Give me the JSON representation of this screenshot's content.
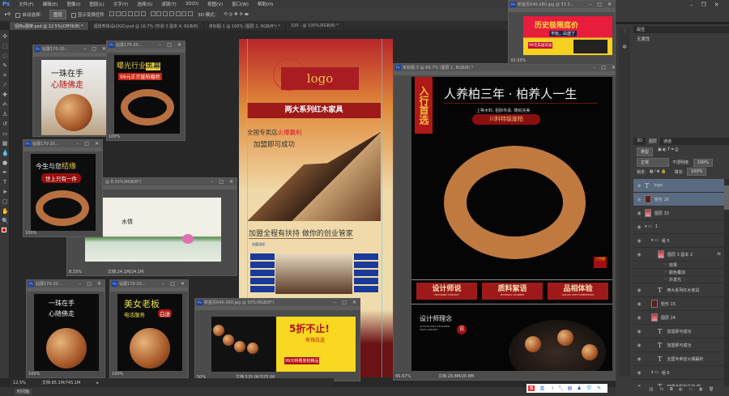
{
  "app": {
    "logo": "Ps",
    "menu": [
      "文件(F)",
      "编辑(E)",
      "图像(I)",
      "图层(L)",
      "文字(Y)",
      "选择(S)",
      "滤镜(T)",
      "3D(D)",
      "视图(V)",
      "窗口(W)",
      "帮助(H)"
    ]
  },
  "options": {
    "auto_select_label": "自动选择：",
    "auto_select_value": "图层",
    "show_transform_label": "显示变换控件",
    "mode_3d": "3D 模式：",
    "workspace_value": "3D"
  },
  "tabs": [
    "招商x展架.psd @ 12.5%(CMYK/8) *",
    "福景寿珠设LOGO.psd @ 16.7% (形状 3 副本 4, RGB/8)",
    "未标题-1 @ 100% (图层 2, RGB/8*) *",
    "320 - @ 100%(RGB/8) *"
  ],
  "windows": {
    "w1": {
      "title": "钻展170-20...",
      "line1": "一珠在手",
      "line2": "心随佛走"
    },
    "w2": {
      "title": "钻展170-20...",
      "line1": "曝光行业",
      "line1b": "黑幕",
      "line2": "99元正宗崖柏瘤疤",
      "zoom": "100%"
    },
    "w3": {
      "title": "钻展170-20...",
      "line1": "今生与您",
      "line1b": "结缘",
      "line2": "世上只有一件",
      "zoom": "100%"
    },
    "w4": {
      "title": "@ 8.33%(RGB/8*)",
      "zoom": "8.33%",
      "doc": "文档:24.1M/24.1M",
      "brush_text": "水情"
    },
    "w5": {
      "title": "钻展170-20...",
      "line1": "一珠在手",
      "line2": "心随佛走",
      "zoom": "100%"
    },
    "w6": {
      "title": "钻展170-20...",
      "line1": "美女老板",
      "line2": "电话服务",
      "badge": "白送",
      "zoom": "100%"
    },
    "w7": {
      "title": "新首页640-280.jpg @ 50%(RGB/8*)",
      "zoom": "50%",
      "doc": "文档:525.0K/525.0K",
      "promo": "5折不止!",
      "promo2": "有钱白送",
      "promo3": "99元特惠崖柏精品"
    },
    "w9": {
      "title": "未标题-3 @ 66.7% (图层 1, RGB/8) *",
      "zoom": "66.67%",
      "doc": "文档:28.8M/20.8M",
      "ribbon": "入行首选",
      "headline": "人养柏三年 · 柏养人一生",
      "sub": "上等木料, 祖脉传承, 铸就完美",
      "pill": "川料特级崖柏",
      "stamp": "三世缘",
      "buttons": [
        {
          "cn": "设计师说",
          "en": "DESIGNER CONCEPT"
        },
        {
          "cn": "质料絮语",
          "en": "MATERIAL WHISPER"
        },
        {
          "cn": "品相体验",
          "en": "GOODS WITH EXPERIENCE"
        }
      ],
      "concept_title": "设计师理念",
      "concept_en": "GUOYISHONG DESIGNER MAIN CONCEPT",
      "concept_badge": "说"
    },
    "w10": {
      "title": "新首页640-280.jpg @ 33.3...",
      "zoom": "33.33%",
      "headline": "历史极限底价",
      "tag": "不玩，白送了",
      "btn": "99元白送白送"
    }
  },
  "poster": {
    "logo": "logo",
    "banner": "两大系列红木家具",
    "line1a": "全国专卖店",
    "line1b": "火爆赢利",
    "line2": "加盟即可成功",
    "slogan": "加盟全程有扶持  做你的创业管家",
    "flow_label": "加盟流程："
  },
  "status": {
    "zoom": "12.5%",
    "doc": "文档:85.1M/745.1M",
    "timeline": "时间轴"
  },
  "properties": {
    "tab": "属性",
    "empty": "无属性"
  },
  "layers_panel": {
    "tabs": [
      "3D",
      "图层",
      "通道"
    ],
    "filter": "类型",
    "blend": "正常",
    "opacity_label": "不透明度:",
    "opacity": "100%",
    "lock_label": "锁定:",
    "fill_label": "填充:",
    "fill": "100%",
    "layers": [
      {
        "name": "logo",
        "type": "text",
        "selected": true,
        "indent": 0
      },
      {
        "name": "矩形 26",
        "type": "shape",
        "selected": true,
        "indent": 0
      },
      {
        "name": "图层 33",
        "type": "image",
        "indent": 0
      },
      {
        "name": "1",
        "type": "group",
        "indent": 0
      },
      {
        "name": "组 5",
        "type": "group",
        "indent": 1
      },
      {
        "name": "图层 3 副本 2",
        "type": "image",
        "indent": 2,
        "fx": "fx"
      },
      {
        "name": "效果",
        "type": "effect",
        "indent": 3
      },
      {
        "name": "颜色叠加",
        "type": "effect",
        "indent": 3
      },
      {
        "name": "外发光",
        "type": "effect",
        "indent": 3
      },
      {
        "name": "两大系列红木家具",
        "type": "text",
        "indent": 2
      },
      {
        "name": "矩形 15",
        "type": "shape",
        "indent": 1
      },
      {
        "name": "图层 24",
        "type": "image",
        "indent": 1
      },
      {
        "name": "加盟即可成功",
        "type": "text",
        "indent": 2
      },
      {
        "name": "加盟即可成功",
        "type": "text",
        "indent": 2
      },
      {
        "name": "全国专卖店火爆赢利",
        "type": "text",
        "indent": 2
      },
      {
        "name": "组 6",
        "type": "group",
        "indent": 1
      },
      {
        "name": "加盟全程有扶持 做...",
        "type": "text",
        "indent": 2
      }
    ]
  },
  "ime": {
    "label": "英"
  }
}
